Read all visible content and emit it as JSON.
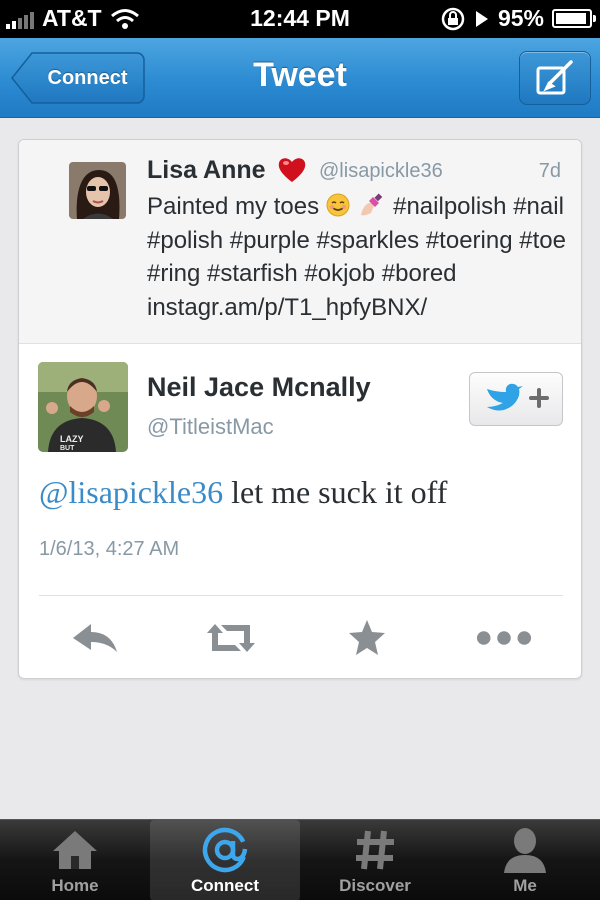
{
  "status_bar": {
    "carrier": "AT&T",
    "time": "12:44 PM",
    "battery": "95%",
    "battery_level": 0.95,
    "icons": [
      "signal-bars-icon",
      "wifi-icon",
      "rotation-lock-icon",
      "location-arrow-icon",
      "battery-icon"
    ]
  },
  "nav": {
    "back_label": "Connect",
    "title": "Tweet",
    "compose_icon": "compose-icon"
  },
  "quoted_tweet": {
    "name": "Lisa Anne",
    "handle": "@lisapickle36",
    "time": "7d",
    "text_start": "Painted my toes",
    "text_rest": "#nailpolish #nail #polish #purple #sparkles #toering #toe #ring #starfish #okjob #bored instagr.am/p/T1_hpfyBNX/",
    "icons": [
      "heart-icon",
      "smiling-face-emoji",
      "nail-polish-emoji"
    ]
  },
  "tweet": {
    "name": "Neil Jace Mcnally",
    "handle": "@TitleistMac",
    "mention": "@lisapickle36",
    "text": "let me suck it off",
    "date": "1/6/13, 4:27 AM",
    "follow_icon": "follow-bird-plus-icon",
    "actions": [
      "reply-icon",
      "retweet-icon",
      "favorite-star-icon",
      "more-dots-icon"
    ]
  },
  "tabs": [
    {
      "label": "Home",
      "icon": "home-icon",
      "active": false
    },
    {
      "label": "Connect",
      "icon": "at-sign-icon",
      "active": true
    },
    {
      "label": "Discover",
      "icon": "hash-icon",
      "active": false
    },
    {
      "label": "Me",
      "icon": "person-icon",
      "active": false
    }
  ],
  "colors": {
    "nav_blue": "#2c8bd2",
    "link_blue": "#3a8bc8",
    "tab_bar": "#151515"
  }
}
